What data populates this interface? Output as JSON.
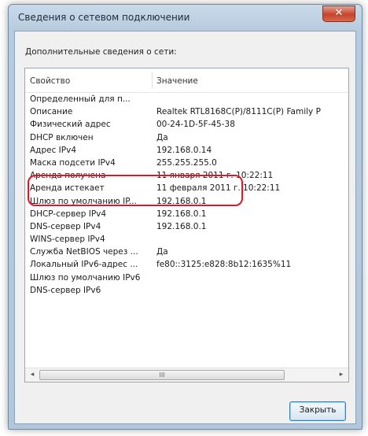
{
  "window": {
    "title": "Сведения о сетевом подключении",
    "close_glyph": "✕"
  },
  "caption": "Дополнительные сведения о сети:",
  "table": {
    "columns": [
      "Свойство",
      "Значение"
    ],
    "rows": [
      [
        "Определенный для п...",
        ""
      ],
      [
        "Описание",
        "Realtek RTL8168C(P)/8111C(P) Family P"
      ],
      [
        "Физический адрес",
        "00-24-1D-5F-45-38"
      ],
      [
        "DHCP включен",
        "Да"
      ],
      [
        "Адрес IPv4",
        "192.168.0.14"
      ],
      [
        "Маска подсети IPv4",
        "255.255.255.0"
      ],
      [
        "Аренда получена",
        "11 января 2011 г. 10:22:11"
      ],
      [
        "Аренда истекает",
        "11 февраля 2011 г. 10:22:11"
      ],
      [
        "Шлюз по умолчанию IP...",
        "192.168.0.1"
      ],
      [
        "DHCP-сервер IPv4",
        "192.168.0.1"
      ],
      [
        "DNS-сервер IPv4",
        "192.168.0.1"
      ],
      [
        "WINS-сервер IPv4",
        ""
      ],
      [
        "Служба NetBIOS через ...",
        "Да"
      ],
      [
        "Локальный IPv6-адрес ...",
        "fe80::3125:e828:8b12:1635%11"
      ],
      [
        "Шлюз по умолчанию IPv6",
        ""
      ],
      [
        "DNS-сервер IPv6",
        ""
      ]
    ]
  },
  "scrollbar": {
    "left_arrow": "◂",
    "right_arrow": "▸",
    "thumb_grip": "III"
  },
  "buttons": {
    "close": "Закрыть"
  },
  "colors": {
    "highlight": "#e0162a",
    "titlebar": "#c9daea"
  }
}
